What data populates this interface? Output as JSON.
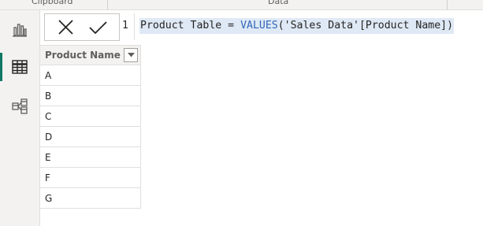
{
  "ribbon": {
    "groups": [
      "Clipboard",
      "Data"
    ]
  },
  "rail": {
    "items": [
      {
        "name": "report-view",
        "icon": "bar-chart-icon",
        "active": false
      },
      {
        "name": "data-view",
        "icon": "table-grid-icon",
        "active": true
      },
      {
        "name": "model-view",
        "icon": "model-diagram-icon",
        "active": false
      }
    ]
  },
  "formula_bar": {
    "line_number": "1",
    "tokens": {
      "name": "Product Table",
      "eq": "=",
      "fn": "VALUES",
      "open": "(",
      "arg": "'Sales Data'[Product Name]",
      "close": ")"
    }
  },
  "table": {
    "column": "Product Name",
    "rows": [
      "A",
      "B",
      "C",
      "D",
      "E",
      "F",
      "G"
    ]
  },
  "colors": {
    "accent": "#117865",
    "function": "#3165bb",
    "selection": "#dfe9f5"
  }
}
